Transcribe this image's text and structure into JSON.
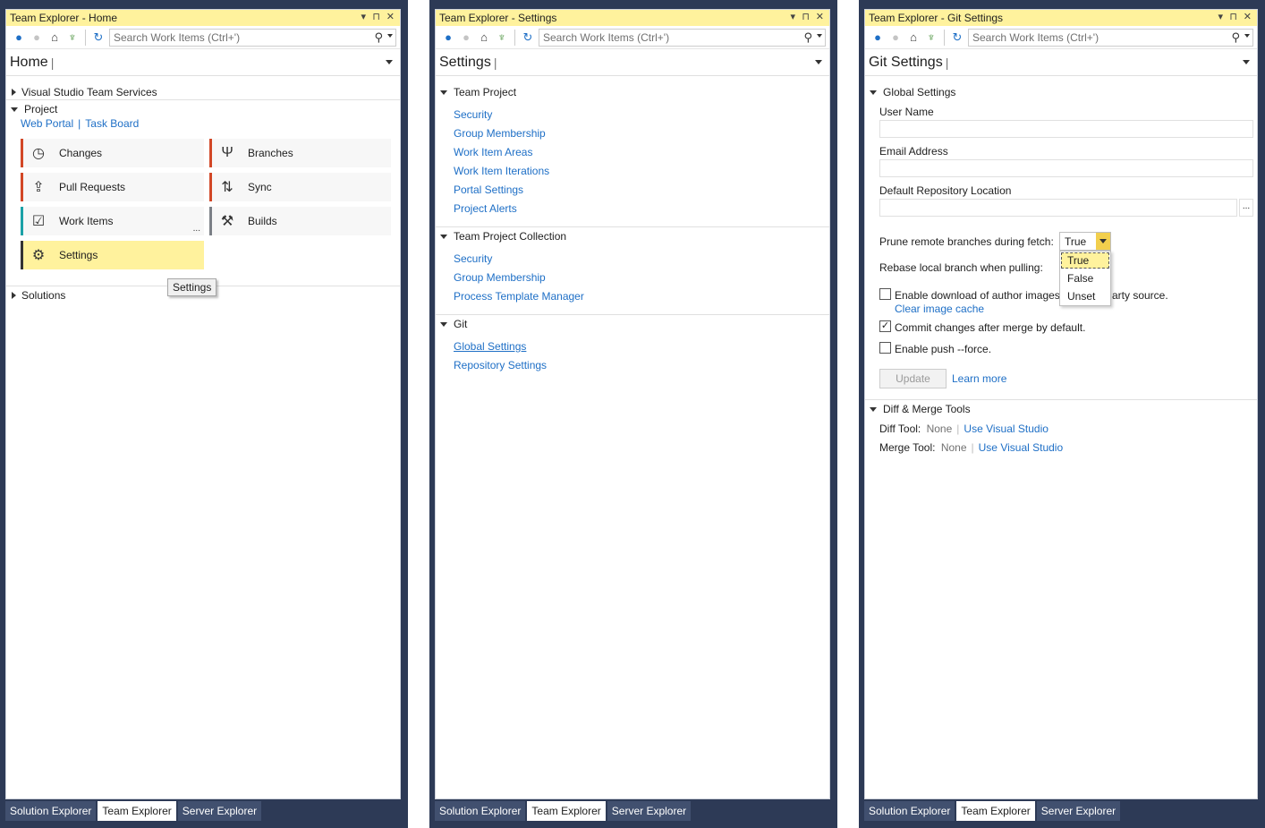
{
  "common": {
    "search_placeholder": "Search Work Items (Ctrl+')",
    "bottom_tabs": [
      "Solution Explorer",
      "Team Explorer",
      "Server Explorer"
    ],
    "titlebar_icons": {
      "dropdown": "▾",
      "pin": "⊓",
      "close": "✕"
    },
    "toolbar_icons": [
      "back-icon",
      "forward-icon",
      "home-icon",
      "connect-icon",
      "refresh-icon"
    ]
  },
  "home": {
    "window_title": "Team Explorer - Home",
    "page_title": "Home",
    "sections": {
      "vsts": "Visual Studio Team Services",
      "project": "Project",
      "solutions": "Solutions"
    },
    "project_links": [
      "Web Portal",
      "Task Board"
    ],
    "tiles": [
      {
        "label": "Changes",
        "icon": "clock-icon"
      },
      {
        "label": "Branches",
        "icon": "branch-icon"
      },
      {
        "label": "Pull Requests",
        "icon": "pull-request-icon"
      },
      {
        "label": "Sync",
        "icon": "sync-icon"
      },
      {
        "label": "Work Items",
        "icon": "work-item-icon"
      },
      {
        "label": "Builds",
        "icon": "build-icon"
      },
      {
        "label": "Settings",
        "icon": "gear-icon"
      }
    ],
    "ellipsis": "...",
    "tooltip": "Settings"
  },
  "settings": {
    "window_title": "Team Explorer - Settings",
    "page_title": "Settings",
    "team_project": {
      "title": "Team Project",
      "links": [
        "Security",
        "Group Membership",
        "Work Item Areas",
        "Work Item Iterations",
        "Portal Settings",
        "Project Alerts"
      ]
    },
    "collection": {
      "title": "Team Project Collection",
      "links": [
        "Security",
        "Group Membership",
        "Process Template Manager"
      ]
    },
    "git": {
      "title": "Git",
      "links": [
        "Global Settings",
        "Repository Settings"
      ]
    }
  },
  "git_settings": {
    "window_title": "Team Explorer - Git Settings",
    "page_title": "Git Settings",
    "global_title": "Global Settings",
    "user_name_label": "User Name",
    "email_label": "Email Address",
    "repo_location_label": "Default Repository Location",
    "browse_label": "...",
    "prune_label": "Prune remote branches during fetch:",
    "prune_value": "True",
    "rebase_label": "Rebase local branch when pulling:",
    "dropdown_options": [
      "True",
      "False",
      "Unset"
    ],
    "author_images_label_a": "Enable download of author images",
    "author_images_label_b": "arty source.",
    "clear_cache": "Clear image cache",
    "commit_after_merge": "Commit changes after merge by default.",
    "push_force": "Enable push --force.",
    "checkbox_states": {
      "author_images": false,
      "commit_after_merge": true,
      "push_force": false
    },
    "update_button": "Update",
    "learn_more": "Learn more",
    "diff_merge_title": "Diff & Merge Tools",
    "diff_tool_label": "Diff Tool:",
    "merge_tool_label": "Merge Tool:",
    "none": "None",
    "use_vs": "Use Visual Studio"
  }
}
